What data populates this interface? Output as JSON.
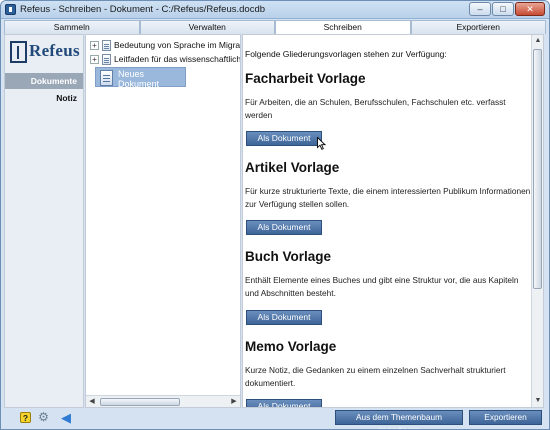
{
  "window": {
    "title": "Refeus - Schreiben - Dokument - C:/Refeus/Refeus.docdb",
    "minimize_glyph": "–",
    "maximize_glyph": "□",
    "close_glyph": "✕"
  },
  "tabs": [
    {
      "label": "Sammeln",
      "active": false
    },
    {
      "label": "Verwalten",
      "active": false
    },
    {
      "label": "Schreiben",
      "active": true
    },
    {
      "label": "Exportieren",
      "active": false
    }
  ],
  "logo": {
    "text": "Refeus"
  },
  "nav": {
    "items": [
      {
        "label": "Dokumente",
        "active": true
      },
      {
        "label": "Notiz",
        "active": false
      }
    ]
  },
  "tree": {
    "items": [
      {
        "label": "Bedeutung von Sprache im Migratio",
        "expander": "+"
      },
      {
        "label": "Leitfaden für das wissenschaftliche",
        "expander": "+"
      }
    ],
    "selected": {
      "label": "Neues Dokument"
    }
  },
  "content": {
    "intro": "Folgende Gliederungsvorlagen stehen zur Verfügung:",
    "templates": [
      {
        "title": "Facharbeit Vorlage",
        "description": "Für Arbeiten, die an Schulen, Berufsschulen, Fachschulen etc. verfasst werden",
        "button": "Als Dokument"
      },
      {
        "title": "Artikel Vorlage",
        "description": "Für kurze strukturierte Texte, die einem interessierten Publikum Informationen zur Verfügung stellen sollen.",
        "button": "Als Dokument"
      },
      {
        "title": "Buch Vorlage",
        "description": "Enthält Elemente eines Buches und gibt eine Struktur vor, die aus Kapiteln und Abschnitten besteht.",
        "button": "Als Dokument"
      },
      {
        "title": "Memo Vorlage",
        "description": "Kurze Notiz, die Gedanken zu einem einzelnen Sachverhalt strukturiert dokumentiert.",
        "button": "Als Dokument"
      }
    ]
  },
  "bottombar": {
    "help_glyph": "?",
    "settings_glyph": "⚙",
    "back_glyph": "◀",
    "import_button": "Aus dem Themenbaum importieren",
    "export_button": "Exportieren"
  },
  "icons": {
    "app": "refeus-app-icon",
    "help": "help-icon",
    "settings": "gear-icon",
    "back": "back-arrow-icon",
    "document": "document-icon"
  },
  "colors": {
    "accent_button": "#3e6598",
    "selection": "#9ab8dc",
    "nav_active": "#9aa7b6",
    "window_chrome": "#d4e2f1"
  }
}
